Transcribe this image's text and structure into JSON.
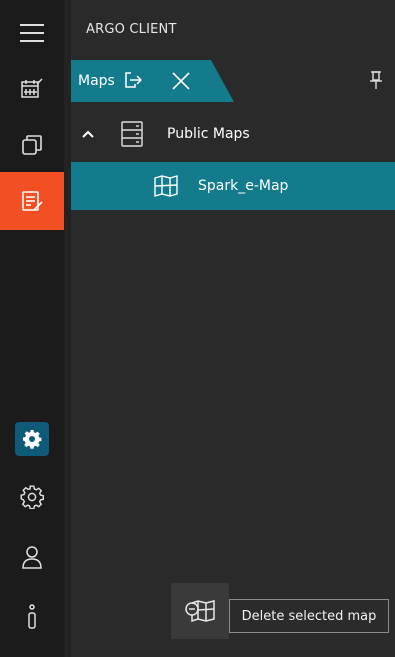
{
  "app": {
    "title": "ARGO CLIENT"
  },
  "rail": {
    "items": [
      {
        "icon": "menu-icon",
        "label": "Menu"
      },
      {
        "icon": "calendar-edit-icon",
        "label": "Schedule"
      },
      {
        "icon": "windows-icon",
        "label": "Windows"
      },
      {
        "icon": "notes-edit-icon",
        "label": "Maps",
        "active": true
      },
      {
        "icon": "gear-icon",
        "label": "Settings highlighted"
      },
      {
        "icon": "gear-outline-icon",
        "label": "Settings"
      },
      {
        "icon": "user-icon",
        "label": "User"
      },
      {
        "icon": "info-icon",
        "label": "Info"
      }
    ],
    "active_color": "#f25022",
    "settings_chip_color": "#0f5a79"
  },
  "tab": {
    "label": "Maps"
  },
  "tree": {
    "group_label": "Public Maps",
    "item_label": "Spark_e-Map",
    "selected_color": "#137b8c"
  },
  "tooltip": {
    "text": "Delete selected map"
  }
}
